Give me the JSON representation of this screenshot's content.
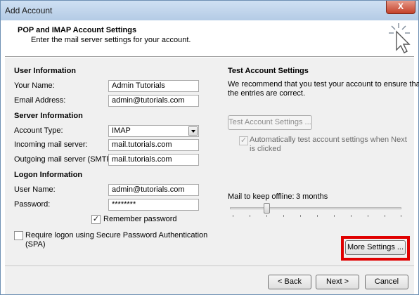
{
  "window": {
    "title": "Add Account",
    "close_label": "X"
  },
  "header": {
    "title": "POP and IMAP Account Settings",
    "subtitle": "Enter the mail server settings for your account."
  },
  "user_info": {
    "heading": "User Information",
    "name_label": "Your Name:",
    "name_value": "Admin Tutorials",
    "email_label": "Email Address:",
    "email_value": "admin@tutorials.com"
  },
  "server_info": {
    "heading": "Server Information",
    "account_type_label": "Account Type:",
    "account_type_value": "IMAP",
    "incoming_label": "Incoming mail server:",
    "incoming_value": "mail.tutorials.com",
    "outgoing_label": "Outgoing mail server (SMTP):",
    "outgoing_value": "mail.tutorials.com"
  },
  "logon_info": {
    "heading": "Logon Information",
    "username_label": "User Name:",
    "username_value": "admin@tutorials.com",
    "password_label": "Password:",
    "password_value": "********",
    "remember_label": "Remember password",
    "remember_checked": true,
    "spa_label_line1": "Require logon using Secure Password Authentication",
    "spa_label_line2": "(SPA)",
    "spa_checked": false
  },
  "test_settings": {
    "heading": "Test Account Settings",
    "desc_line1": "We recommend that you test your account to ensure that",
    "desc_line2": "the entries are correct.",
    "test_button": "Test Account Settings ...",
    "auto_test_line1": "Automatically test account settings when Next",
    "auto_test_line2": "is clicked",
    "auto_test_checked": true
  },
  "offline": {
    "label": "Mail to keep offline:",
    "value": "3 months",
    "slider_level": 0.2
  },
  "more_settings_button": "More Settings ...",
  "footer": {
    "back": "< Back",
    "next": "Next >",
    "cancel": "Cancel"
  }
}
